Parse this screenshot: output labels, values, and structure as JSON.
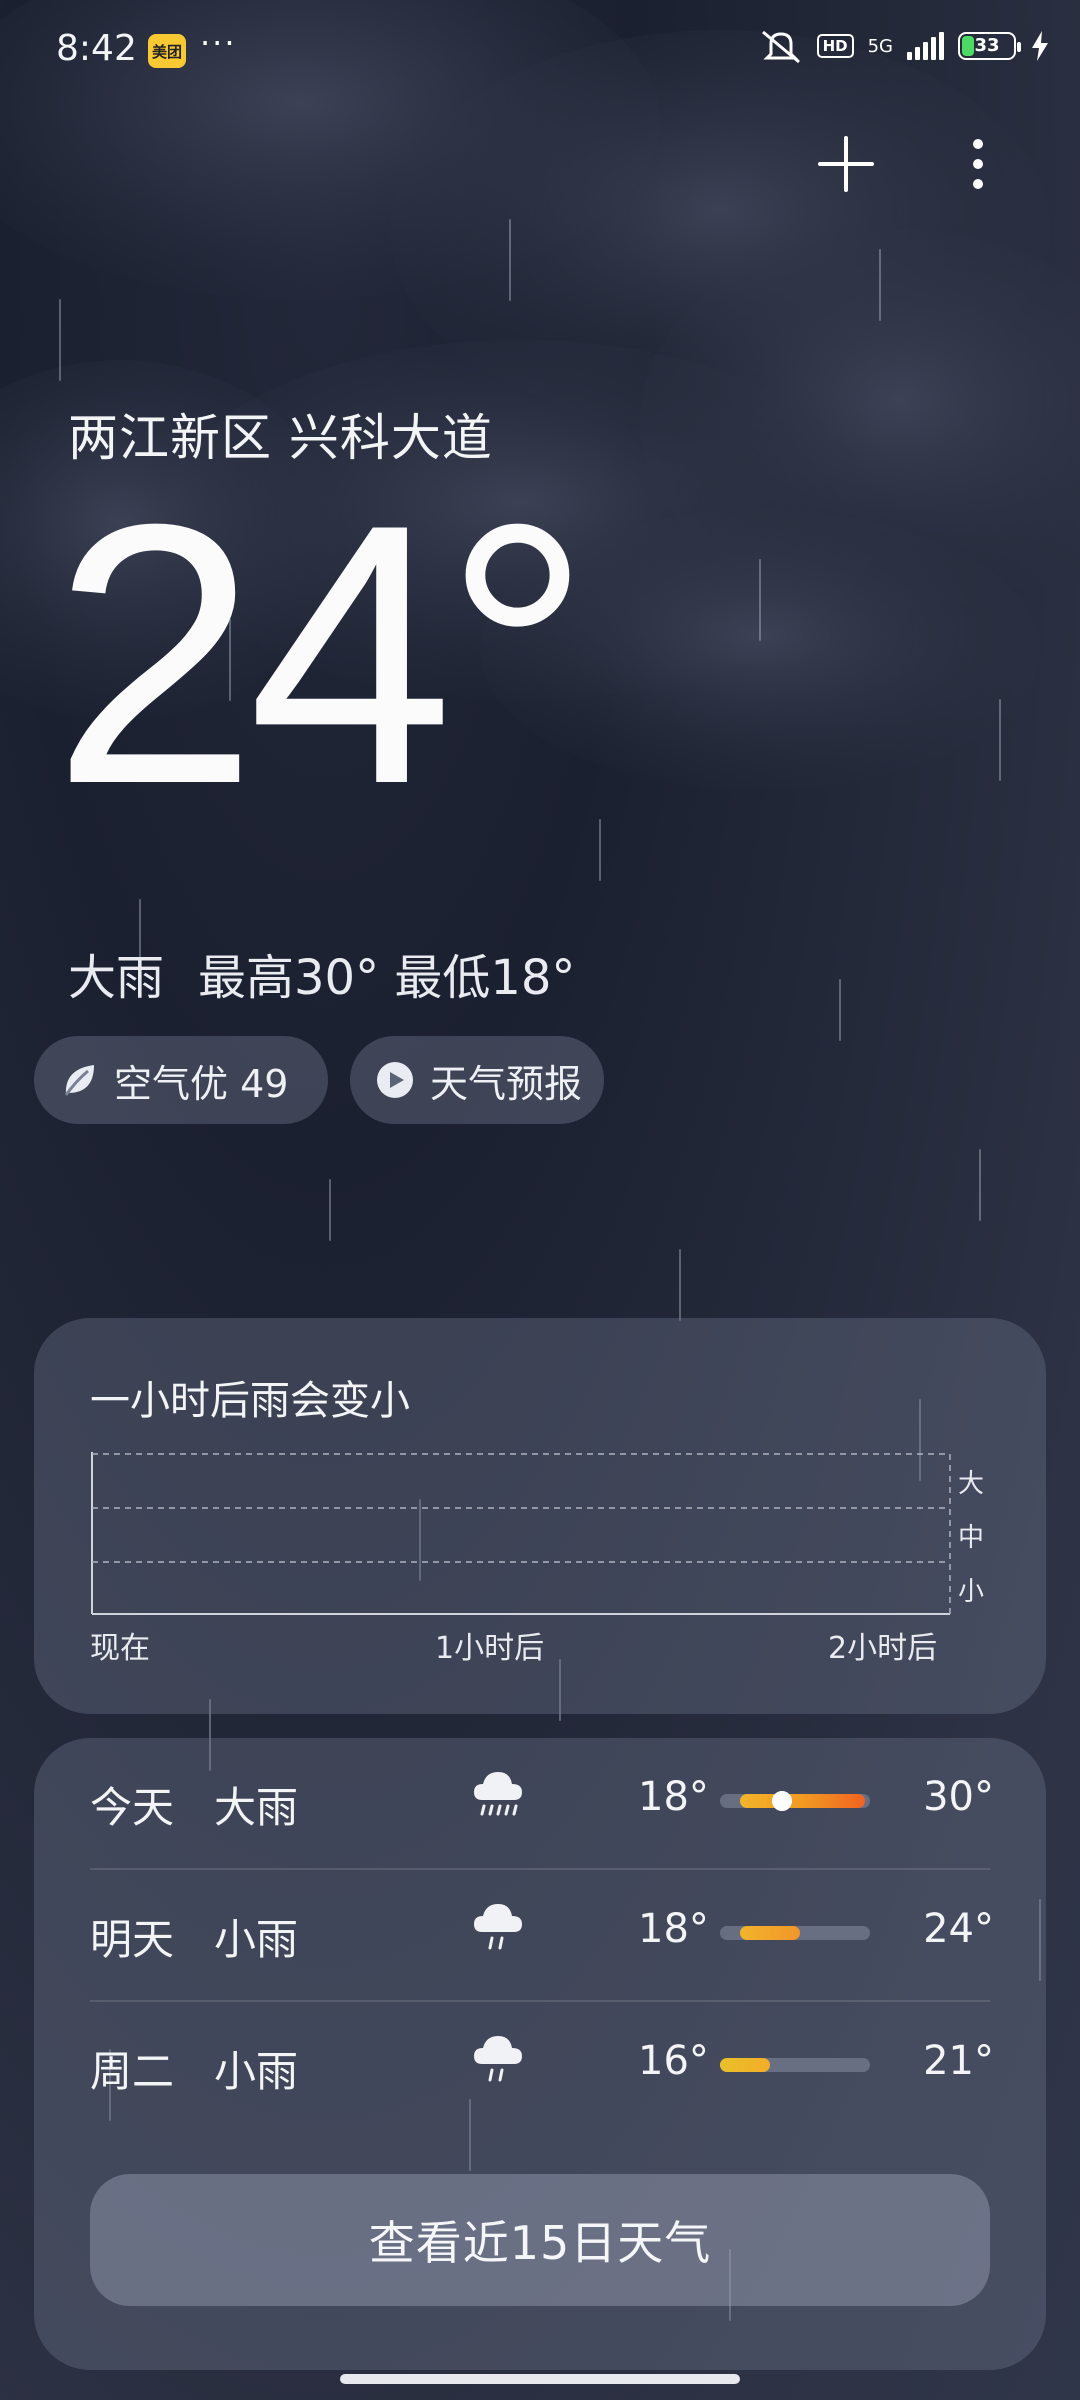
{
  "status_bar": {
    "time": "8:42",
    "app_badge": "美团",
    "more": "···",
    "hd": "HD",
    "network": "5G",
    "battery": "33"
  },
  "location": "两江新区 兴科大道",
  "temperature": "24°",
  "condition": "大雨",
  "high_low": "最高30° 最低18°",
  "chips": {
    "air_quality": "空气优 49",
    "forecast_video": "天气预报"
  },
  "rain_card": {
    "title": "一小时后雨会变小",
    "levels": [
      "大",
      "中",
      "小"
    ],
    "time_labels": [
      "现在",
      "1小时后",
      "2小时后"
    ]
  },
  "forecast": {
    "days": [
      {
        "day": "今天",
        "weather": "大雨",
        "icon": "heavy-rain-icon",
        "low": "18°",
        "high": "30°"
      },
      {
        "day": "明天",
        "weather": "小雨",
        "icon": "light-rain-icon",
        "low": "18°",
        "high": "24°"
      },
      {
        "day": "周二",
        "weather": "小雨",
        "icon": "light-rain-icon",
        "low": "16°",
        "high": "21°"
      }
    ],
    "button": "查看近15日天气"
  },
  "colors": {
    "bar_yellow": "#f2b42a",
    "bar_orange": "#f26322",
    "air_leaf": "#e9ecf2"
  }
}
